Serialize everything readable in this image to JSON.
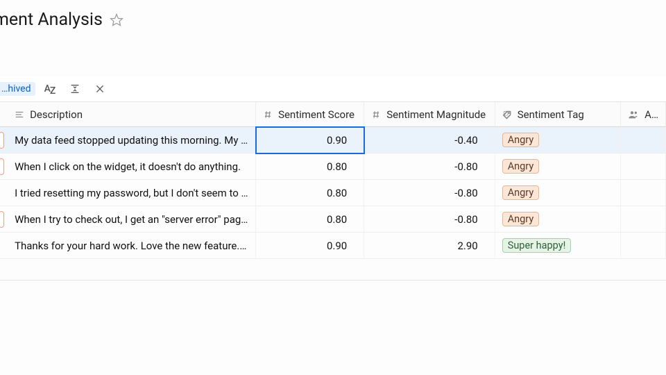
{
  "header": {
    "title": "…timent Analysis"
  },
  "toolbar": {
    "filter_chip": "…hived"
  },
  "columns": {
    "description": "Description",
    "score": "Sentiment Score",
    "magnitude": "Sentiment Magnitude",
    "tag": "Sentiment Tag",
    "extra": "A…"
  },
  "rows": [
    {
      "chip": "red",
      "description": "My data feed stopped updating this morning. My …",
      "score": "0.90",
      "magnitude": "-0.40",
      "tag": "Angry",
      "tag_class": "angry",
      "selected": true
    },
    {
      "chip": "red",
      "description": "When I click on the widget, it doesn't do anything.",
      "score": "0.80",
      "magnitude": "-0.80",
      "tag": "Angry",
      "tag_class": "angry",
      "selected": false
    },
    {
      "chip": "blank",
      "description": "I tried resetting my password, but I don't seem to …",
      "score": "0.80",
      "magnitude": "-0.80",
      "tag": "Angry",
      "tag_class": "angry",
      "selected": false
    },
    {
      "chip": "red",
      "description": "When I try to check out, I get an \"server error\" pag…",
      "score": "0.80",
      "magnitude": "-0.80",
      "tag": "Angry",
      "tag_class": "angry",
      "selected": false
    },
    {
      "chip": "blank",
      "description": "Thanks for your hard work. Love the new feature. …",
      "score": "0.90",
      "magnitude": "2.90",
      "tag": "Super happy!",
      "tag_class": "happy",
      "selected": false
    }
  ]
}
